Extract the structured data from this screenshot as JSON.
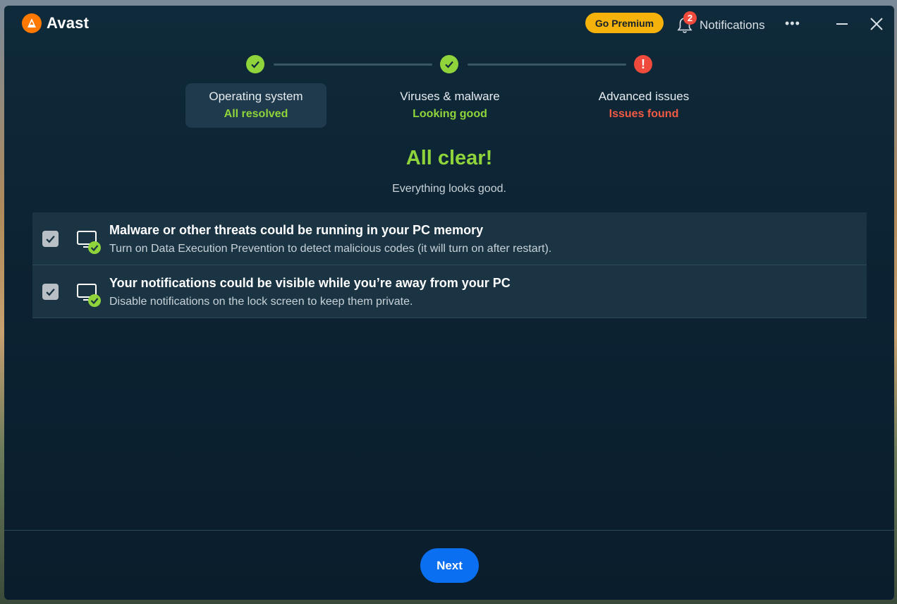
{
  "app": {
    "name": "Avast",
    "brand_color": "#ff7800"
  },
  "header": {
    "premium_label": "Go Premium",
    "notifications_label": "Notifications",
    "notifications_count": "2",
    "more_icon": "more-horizontal-icon",
    "minimize_icon": "minimize-icon",
    "close_icon": "close-icon"
  },
  "steps": [
    {
      "title": "Operating system",
      "status": "All resolved",
      "state": "ok",
      "active": true
    },
    {
      "title": "Viruses & malware",
      "status": "Looking good",
      "state": "ok",
      "active": false
    },
    {
      "title": "Advanced issues",
      "status": "Issues found",
      "state": "error",
      "active": false
    }
  ],
  "result": {
    "headline": "All clear!",
    "subline": "Everything looks good."
  },
  "issues": [
    {
      "title": "Malware or other threats could be running in your PC memory",
      "description": "Turn on Data Execution Prevention to detect malicious codes (it will turn on after restart).",
      "checked": true
    },
    {
      "title": "Your notifications could be visible while you’re away from your PC",
      "description": "Disable notifications on the lock screen to keep them private.",
      "checked": true
    }
  ],
  "footer": {
    "next_label": "Next"
  },
  "colors": {
    "success": "#8fd43a",
    "error": "#f25a44",
    "premium": "#f5b20a",
    "primary_button": "#0a6ff0"
  }
}
